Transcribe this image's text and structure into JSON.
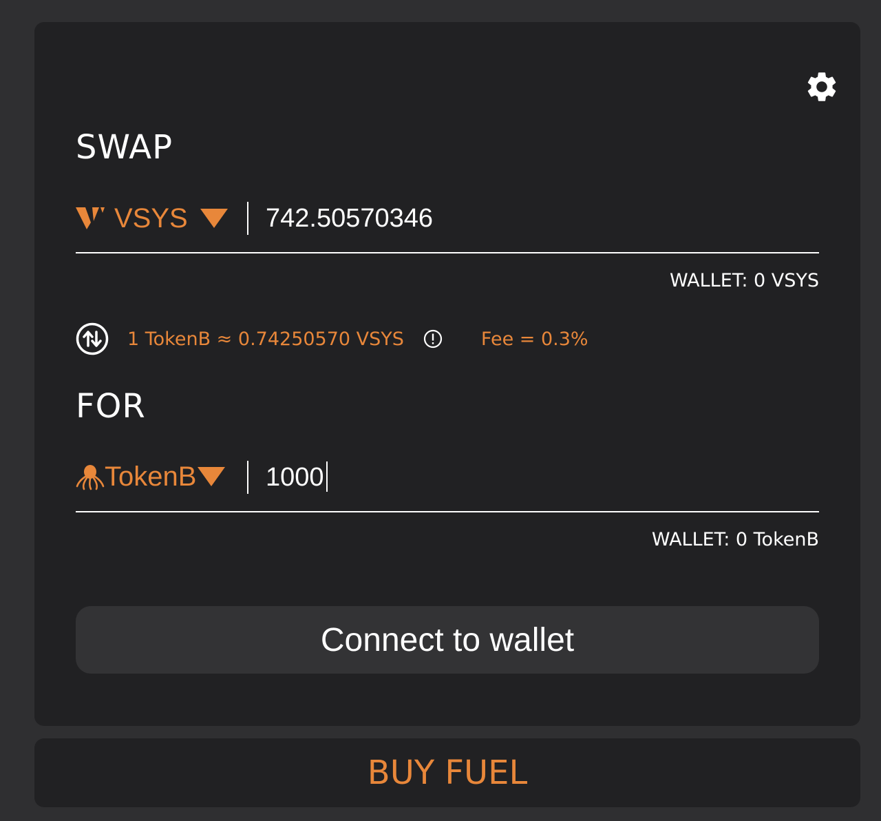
{
  "colors": {
    "background": "#2f2f31",
    "panel": "#212123",
    "accent": "#e8873a",
    "text": "#ffffff",
    "button": "#333335"
  },
  "settings": {
    "icon": "gear-icon"
  },
  "swap": {
    "title": "SWAP",
    "token": {
      "name": "VSYS",
      "icon": "vsys-logo-icon"
    },
    "amount": "742.50570346",
    "wallet": "WALLET: 0 VSYS"
  },
  "rate": {
    "icon": "swap-arrows-icon",
    "text": "1 TokenB ≈ 0.74250570 VSYS",
    "info_icon": "info-icon",
    "fee": "Fee = 0.3%"
  },
  "for": {
    "title": "FOR",
    "token": {
      "name": "TokenB",
      "icon": "octopus-icon"
    },
    "amount": "1000",
    "wallet": "WALLET: 0 TokenB"
  },
  "connect_button": "Connect to wallet",
  "buy_fuel": "BUY FUEL"
}
